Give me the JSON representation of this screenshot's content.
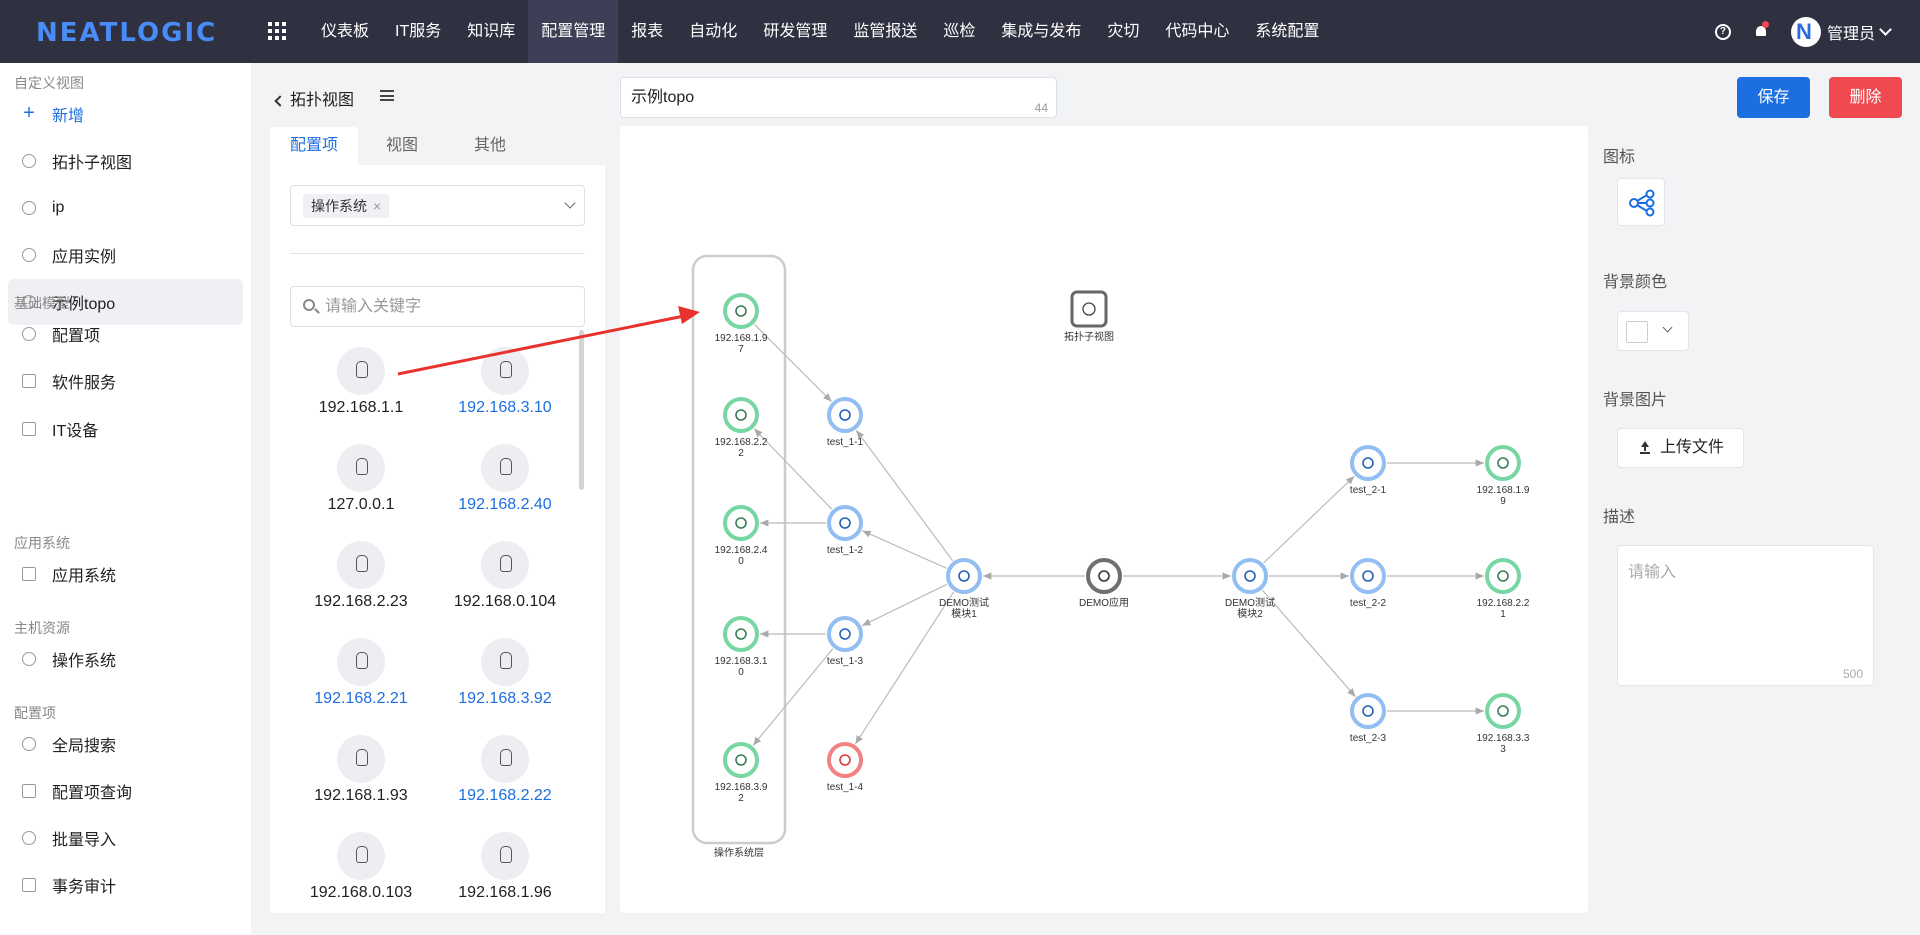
{
  "header": {
    "logo": "NEATLOGIC",
    "nav": [
      "仪表板",
      "IT服务",
      "知识库",
      "配置管理",
      "报表",
      "自动化",
      "研发管理",
      "监管报送",
      "巡检",
      "集成与发布",
      "灾切",
      "代码中心",
      "系统配置"
    ],
    "active_nav": "配置管理",
    "help_icon": "?",
    "user": "管理员"
  },
  "sidebar": {
    "groups": [
      {
        "title": "自定义视图",
        "items": [
          {
            "label": "新增",
            "icon": "plus-icon"
          },
          {
            "label": "拓扑子视图",
            "icon": "help-circle-icon"
          },
          {
            "label": "ip",
            "icon": "ci-icon"
          },
          {
            "label": "应用实例",
            "icon": "ci-icon"
          },
          {
            "label": "示例topo",
            "icon": "topology-icon"
          }
        ]
      },
      {
        "title": "基础模型",
        "items": [
          {
            "label": "配置项",
            "icon": "ci-icon"
          },
          {
            "label": "软件服务",
            "icon": "folder-icon"
          },
          {
            "label": "IT设备",
            "icon": "device-icon"
          }
        ]
      },
      {
        "title": "应用系统",
        "items": [
          {
            "label": "应用系统",
            "icon": "app-icon"
          }
        ]
      },
      {
        "title": "主机资源",
        "items": [
          {
            "label": "操作系统",
            "icon": "gear-icon"
          }
        ]
      },
      {
        "title": "配置项",
        "items": [
          {
            "label": "全局搜索",
            "icon": "search-icon"
          },
          {
            "label": "配置项查询",
            "icon": "query-icon"
          },
          {
            "label": "批量导入",
            "icon": "cloud-upload-icon"
          },
          {
            "label": "事务审计",
            "icon": "audit-icon"
          }
        ]
      }
    ]
  },
  "panel": {
    "back_label": "拓扑视图",
    "tabs": [
      "配置项",
      "视图",
      "其他"
    ],
    "filter_tag": "操作系统",
    "filter_tag_close": "×",
    "search_placeholder": "请输入关键字",
    "items": [
      {
        "label": "192.168.1.1",
        "blue": false
      },
      {
        "label": "192.168.3.10",
        "blue": true
      },
      {
        "label": "127.0.0.1",
        "blue": false
      },
      {
        "label": "192.168.2.40",
        "blue": true
      },
      {
        "label": "192.168.2.23",
        "blue": false
      },
      {
        "label": "192.168.0.104",
        "blue": false
      },
      {
        "label": "192.168.2.21",
        "blue": true
      },
      {
        "label": "192.168.3.92",
        "blue": true
      },
      {
        "label": "192.168.1.93",
        "blue": false
      },
      {
        "label": "192.168.2.22",
        "blue": true
      },
      {
        "label": "192.168.0.103",
        "blue": false
      },
      {
        "label": "192.168.1.96",
        "blue": false
      }
    ]
  },
  "editor": {
    "title_value": "示例topo",
    "title_count": "44",
    "save_label": "保存",
    "delete_label": "删除"
  },
  "canvas": {
    "group_label": "操作系统层",
    "nodes": [
      {
        "id": "n197",
        "lines": [
          "192.168.1.9",
          "7"
        ],
        "kind": "os"
      },
      {
        "id": "n222",
        "lines": [
          "192.168.2.2",
          "2"
        ],
        "kind": "os"
      },
      {
        "id": "n240",
        "lines": [
          "192.168.2.4",
          "0"
        ],
        "kind": "os"
      },
      {
        "id": "n310",
        "lines": [
          "192.168.3.1",
          "0"
        ],
        "kind": "os"
      },
      {
        "id": "n392",
        "lines": [
          "192.168.3.9",
          "2"
        ],
        "kind": "os"
      },
      {
        "id": "t11",
        "lines": [
          "test_1-1"
        ],
        "kind": "svc"
      },
      {
        "id": "t12",
        "lines": [
          "test_1-2"
        ],
        "kind": "svc"
      },
      {
        "id": "t13",
        "lines": [
          "test_1-3"
        ],
        "kind": "svc"
      },
      {
        "id": "t14",
        "lines": [
          "test_1-4"
        ],
        "kind": "err"
      },
      {
        "id": "m1",
        "lines": [
          "DEMO测试",
          "模块1"
        ],
        "kind": "mod"
      },
      {
        "id": "app",
        "lines": [
          "DEMO应用"
        ],
        "kind": "app"
      },
      {
        "id": "m2",
        "lines": [
          "DEMO测试",
          "模块2"
        ],
        "kind": "mod"
      },
      {
        "id": "t21",
        "lines": [
          "test_2-1"
        ],
        "kind": "svc"
      },
      {
        "id": "t22",
        "lines": [
          "test_2-2"
        ],
        "kind": "svc"
      },
      {
        "id": "t23",
        "lines": [
          "test_2-3"
        ],
        "kind": "svc"
      },
      {
        "id": "n199",
        "lines": [
          "192.168.1.9",
          "9"
        ],
        "kind": "os"
      },
      {
        "id": "n221",
        "lines": [
          "192.168.2.2",
          "1"
        ],
        "kind": "os"
      },
      {
        "id": "n333",
        "lines": [
          "192.168.3.3",
          "3"
        ],
        "kind": "os"
      },
      {
        "id": "sub",
        "lines": [
          "拓扑子视图"
        ],
        "kind": "sub"
      }
    ],
    "edges": [
      [
        "n197",
        "t11"
      ],
      [
        "t12",
        "n222"
      ],
      [
        "t12",
        "n240"
      ],
      [
        "t13",
        "n310"
      ],
      [
        "t13",
        "n392"
      ],
      [
        "m1",
        "t11"
      ],
      [
        "m1",
        "t12"
      ],
      [
        "m1",
        "t13"
      ],
      [
        "m1",
        "t14"
      ],
      [
        "app",
        "m1"
      ],
      [
        "app",
        "m2"
      ],
      [
        "m2",
        "t21"
      ],
      [
        "m2",
        "t22"
      ],
      [
        "m2",
        "t23"
      ],
      [
        "t21",
        "n199"
      ],
      [
        "t22",
        "n221"
      ],
      [
        "t23",
        "n333"
      ]
    ]
  },
  "props": {
    "icon_label": "图标",
    "bg_color_label": "背景颜色",
    "bg_image_label": "背景图片",
    "upload_label": "上传文件",
    "desc_label": "描述",
    "desc_placeholder": "请输入",
    "desc_max": "500"
  },
  "colors": {
    "primary": "#1c6fe0",
    "danger": "#f04950",
    "os_node": "#5fcf91",
    "svc_node": "#7fb3ee",
    "err_node": "#f06b6b",
    "arrow": "#e8322e"
  }
}
